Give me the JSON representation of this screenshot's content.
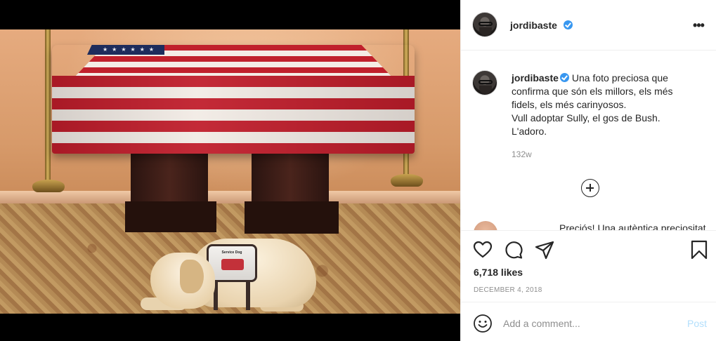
{
  "post": {
    "username": "jordibaste",
    "verified": true,
    "caption_lines": [
      "Una foto preciosa que",
      "confirma que són els millors, els més",
      "fidels, els més carinyosos.",
      "Vull adoptar Sully, el gos de Bush.",
      "L'adoro."
    ],
    "age": "132w",
    "partial_comment_text": "Preciós! Una autèntica preciositat",
    "likes": "6,718 likes",
    "date": "DECEMBER 4, 2018"
  },
  "comment_box": {
    "placeholder": "Add a comment...",
    "post_label": "Post"
  },
  "photo": {
    "vest_label": "Service Dog"
  },
  "icons": {
    "more": "more-options-icon",
    "verified": "verified-badge-icon",
    "load_more": "load-more-comments-icon",
    "like": "heart-icon",
    "comment": "comment-icon",
    "share": "share-icon",
    "save": "bookmark-icon",
    "emoji": "emoji-icon"
  },
  "colors": {
    "verified": "#3897f0",
    "post_button_disabled": "#b2dffc",
    "muted_text": "#8e8e8e",
    "text": "#262626"
  }
}
